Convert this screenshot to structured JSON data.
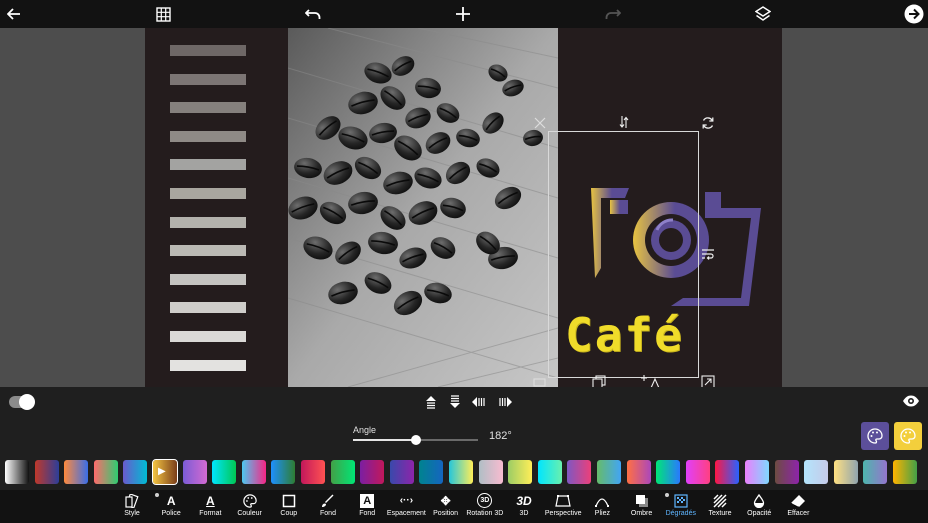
{
  "colors": {
    "accent_purple": "#5c4f9a",
    "accent_yellow": "#f3cf3c",
    "active_blue": "#5fb5ff",
    "cafe_text": "#f0dc2a"
  },
  "topbar": {
    "back_icon": "arrow-left-icon",
    "grid_icon": "grid-icon",
    "undo_icon": "undo-icon",
    "add_icon": "plus-icon",
    "redo_icon": "redo-icon",
    "layers_icon": "layers-icon",
    "next_icon": "arrow-right-circle-icon"
  },
  "canvas": {
    "stripe_colors": [
      "#6e6766",
      "#7c7574",
      "#85807d",
      "#8f8a86",
      "#a3a3a1",
      "#a9a69f",
      "#b3b1ac",
      "#bbb9b4",
      "#c4c3c0",
      "#cfcdca",
      "#dad8d6",
      "#e3e2e0"
    ],
    "logo_text": "Café"
  },
  "controls": {
    "toggle_on": true,
    "angle_label": "Angle",
    "angle_value": "182°",
    "angle_fraction": 0.5,
    "align_icons": [
      "align-top-icon",
      "align-bottom-icon",
      "align-left-icon",
      "align-right-icon"
    ]
  },
  "gradients": [
    [
      "#ffffff",
      "#111111"
    ],
    [
      "#c0392b",
      "#2c3e99"
    ],
    [
      "#ff8a3d",
      "#3a6ee8"
    ],
    [
      "#ff6b6b",
      "#2ecc71"
    ],
    [
      "#6a5acd",
      "#00bcd4"
    ],
    [
      "#f4c542",
      "#7a3e1a"
    ],
    [
      "#7b5cd6",
      "#d46ad1"
    ],
    [
      "#00e5ff",
      "#00c853"
    ],
    [
      "#4cc9f0",
      "#f72585"
    ],
    [
      "#1e90ff",
      "#2e7d32"
    ],
    [
      "#c2185b",
      "#ff5252"
    ],
    [
      "#43a047",
      "#00e676"
    ],
    [
      "#7b1fa2",
      "#c2185b"
    ],
    [
      "#3949ab",
      "#8e24aa"
    ],
    [
      "#00838f",
      "#1565c0"
    ],
    [
      "#26c6da",
      "#ffee58"
    ],
    [
      "#b0bec5",
      "#f8bbd0"
    ],
    [
      "#9ccc65",
      "#ffee58"
    ],
    [
      "#00e5ff",
      "#69f0ae"
    ],
    [
      "#7e57c2",
      "#ec407a"
    ],
    [
      "#66bb6a",
      "#42a5f5"
    ],
    [
      "#ff7043",
      "#ab47bc"
    ],
    [
      "#00e676",
      "#2979ff"
    ],
    [
      "#e040fb",
      "#ff4081"
    ],
    [
      "#ff1744",
      "#2962ff"
    ],
    [
      "#ea80fc",
      "#80d8ff"
    ],
    [
      "#6d4c41",
      "#8e24aa"
    ],
    [
      "#b3e5fc",
      "#c5cae9"
    ],
    [
      "#ffe082",
      "#90a4ae"
    ],
    [
      "#4db6ac",
      "#9575cd"
    ],
    [
      "#ffb300",
      "#43a047"
    ]
  ],
  "selected_gradient_icon": "play-arrow-icon",
  "toolbar": {
    "items": [
      {
        "label": "Style",
        "icon": "style-icon",
        "glyph": "",
        "active": false,
        "dot": false
      },
      {
        "label": "Police",
        "icon": "font-icon",
        "glyph": "A",
        "active": false,
        "dot": true
      },
      {
        "label": "Format",
        "icon": "format-icon",
        "glyph": "A",
        "active": false,
        "dot": false
      },
      {
        "label": "Couleur",
        "icon": "palette-icon",
        "glyph": "",
        "active": false,
        "dot": false
      },
      {
        "label": "Coup",
        "icon": "stroke-icon",
        "glyph": "",
        "active": false,
        "dot": false
      },
      {
        "label": "Fond",
        "icon": "brush-icon",
        "glyph": "",
        "active": false,
        "dot": false
      },
      {
        "label": "Fond",
        "icon": "background-letter-icon",
        "glyph": "A",
        "active": false,
        "dot": false
      },
      {
        "label": "Espacement",
        "icon": "spacing-icon",
        "glyph": "‹··›",
        "active": false,
        "dot": false
      },
      {
        "label": "Position",
        "icon": "move-icon",
        "glyph": "✥",
        "active": false,
        "dot": false
      },
      {
        "label": "Rotation 3D",
        "icon": "rotation-3d-icon",
        "glyph": "3D",
        "active": false,
        "dot": false
      },
      {
        "label": "3D",
        "icon": "text-3d-icon",
        "glyph": "3D",
        "active": false,
        "dot": false
      },
      {
        "label": "Perspective",
        "icon": "perspective-icon",
        "glyph": "",
        "active": false,
        "dot": false
      },
      {
        "label": "Pliez",
        "icon": "curve-icon",
        "glyph": "",
        "active": false,
        "dot": false
      },
      {
        "label": "Ombre",
        "icon": "shadow-icon",
        "glyph": "",
        "active": false,
        "dot": false
      },
      {
        "label": "Dégradés",
        "icon": "gradient-icon",
        "glyph": "",
        "active": true,
        "dot": true
      },
      {
        "label": "Texture",
        "icon": "texture-icon",
        "glyph": "",
        "active": false,
        "dot": false
      },
      {
        "label": "Opacité",
        "icon": "opacity-icon",
        "glyph": "",
        "active": false,
        "dot": false
      },
      {
        "label": "Effacer",
        "icon": "eraser-icon",
        "glyph": "",
        "active": false,
        "dot": false
      }
    ]
  }
}
